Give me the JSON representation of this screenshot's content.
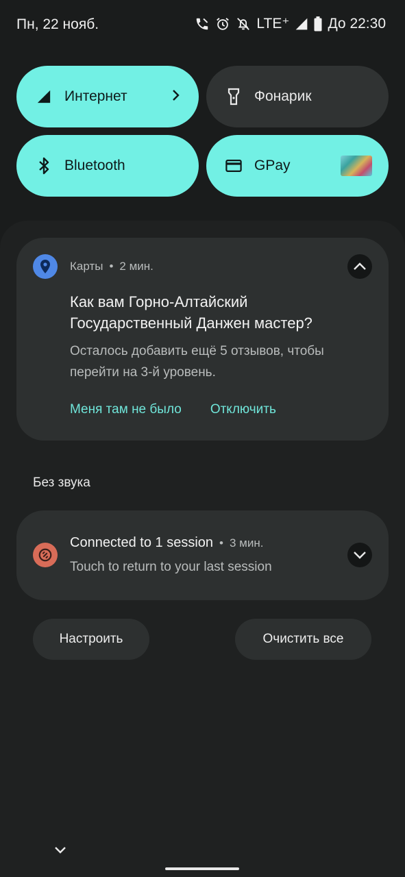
{
  "status_bar": {
    "date": "Пн, 22 нояб.",
    "network": "LTE⁺",
    "alarm_time": "До 22:30",
    "icons": [
      "wifi-calling-icon",
      "alarm-icon",
      "notifications-off-icon",
      "signal-icon",
      "battery-icon"
    ]
  },
  "quick_tiles": [
    {
      "label": "Интернет",
      "icon": "signal-icon",
      "state": "on",
      "has_chevron": true
    },
    {
      "label": "Фонарик",
      "icon": "flashlight-icon",
      "state": "off"
    },
    {
      "label": "Bluetooth",
      "icon": "bluetooth-icon",
      "state": "on"
    },
    {
      "label": "GPay",
      "icon": "card-icon",
      "state": "on",
      "has_card_thumbnail": true
    }
  ],
  "notifications": {
    "maps": {
      "app": "Карты",
      "time": "2 мин.",
      "title": "Как вам Горно-Алтайский Государственный Данжен мастер?",
      "body": "Осталось добавить ещё 5 отзывов, чтобы перейти на 3-й уровень.",
      "actions": [
        "Меня там не было",
        "Отключить"
      ],
      "expanded": true
    },
    "silent_label": "Без звука",
    "session": {
      "title": "Connected to 1 session",
      "time": "3 мин.",
      "body": "Touch to return to your last session",
      "expanded": false
    }
  },
  "buttons": {
    "settings": "Настроить",
    "clear_all": "Очистить все"
  },
  "colors": {
    "tile_on": "#72f0e4",
    "tile_off": "#303333",
    "accent_text": "#70e6da",
    "background": "#1a1c1c",
    "card": "#2d3030"
  }
}
